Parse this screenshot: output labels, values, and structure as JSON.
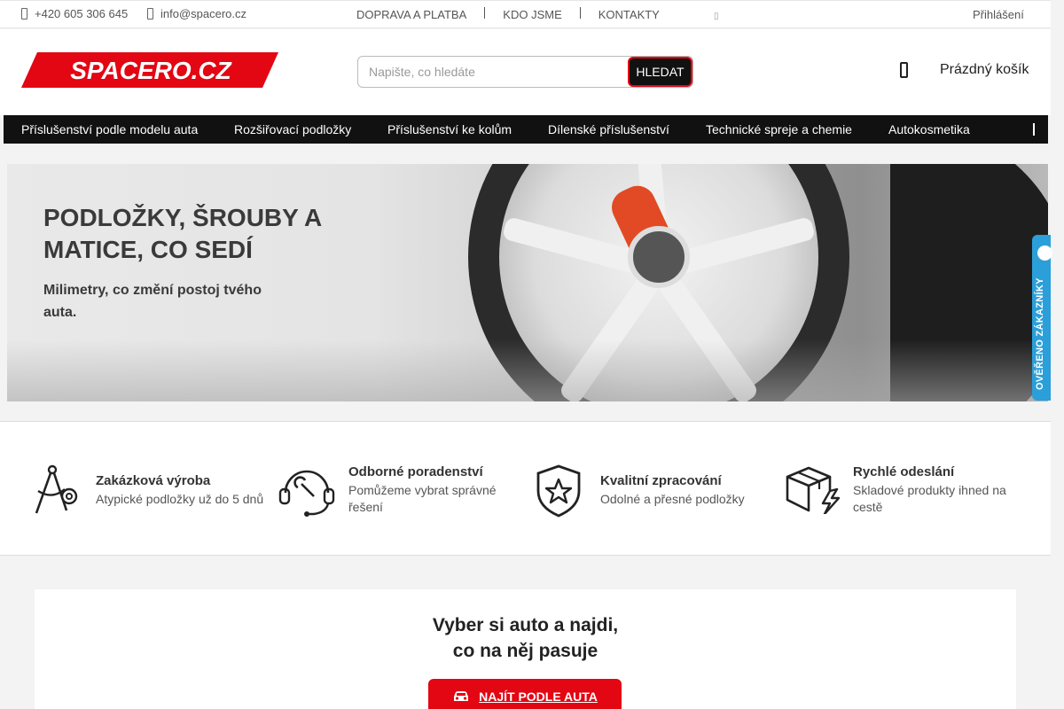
{
  "topbar": {
    "phone": "+420 605 306 645",
    "email": "info@spacero.cz",
    "links": [
      "DOPRAVA A PLATBA",
      "KDO JSME",
      "KONTAKTY"
    ],
    "login": "Přihlášení"
  },
  "header": {
    "logo_text": "SPACERO.CZ",
    "search_placeholder": "Napište, co hledáte",
    "search_button": "HLEDAT",
    "cart_label": "Prázdný košík"
  },
  "menu": {
    "items": [
      "Příslušenství podle modelu auta",
      "Rozšiřovací podložky",
      "Příslušenství ke kolům",
      "Dílenské příslušenství",
      "Technické spreje a chemie",
      "Autokosmetika"
    ]
  },
  "banner": {
    "headline": "PODLOŽKY, ŠROUBY A MATICE, CO SEDÍ",
    "subline": "Milimetry, co změní postoj tvého auta."
  },
  "verified_badge": "OVĚŘENO ZÁKAZNÍKY",
  "features": [
    {
      "icon": "compass-icon",
      "title": "Zakázková výroba",
      "desc": "Atypické podložky už do 5 dnů"
    },
    {
      "icon": "support-icon",
      "title": "Odborné poradenství",
      "desc": "Pomůžeme vybrat správné řešení"
    },
    {
      "icon": "shield-star-icon",
      "title": "Kvalitní zpracování",
      "desc": "Odolné a přesné podložky"
    },
    {
      "icon": "fast-box-icon",
      "title": "Rychlé odeslání",
      "desc": "Skladové produkty ihned na cestě"
    }
  ],
  "finder": {
    "title_line1": "Vyber si auto a najdi,",
    "title_line2": "co na něj pasuje",
    "cta": "NAJÍT PODLE AUTA"
  },
  "colors": {
    "brand_red": "#e30613",
    "menu_bg": "#111111",
    "badge_blue": "#2b9fd9"
  }
}
